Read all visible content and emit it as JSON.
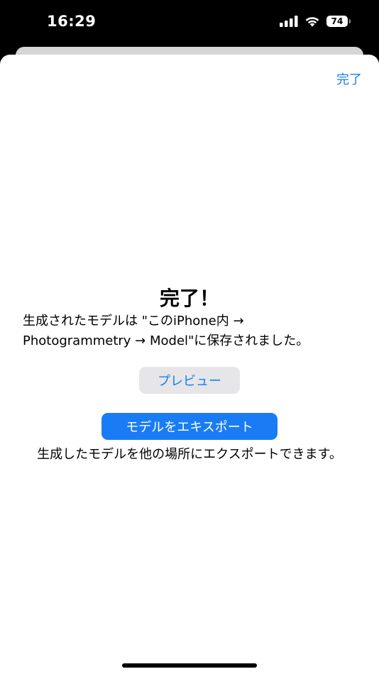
{
  "status_bar": {
    "time": "16:29",
    "battery": "74",
    "icons": [
      "signal-icon",
      "wifi-icon",
      "battery-icon"
    ]
  },
  "sheet": {
    "done_label": "完了",
    "title": "完了！",
    "description_line1": "生成されたモデルは \"このiPhone内 →",
    "description_line2": "Photogrammetry → Model\"に保存されました。",
    "preview_label": "プレビュー",
    "export_label": "モデルをエキスポート",
    "export_description": "生成したモデルを他の場所にエクスポートできます。"
  },
  "colors": {
    "accent": "#1a7cf5",
    "secondary_button_bg": "#e6e6e8",
    "background": "#ffffff"
  }
}
